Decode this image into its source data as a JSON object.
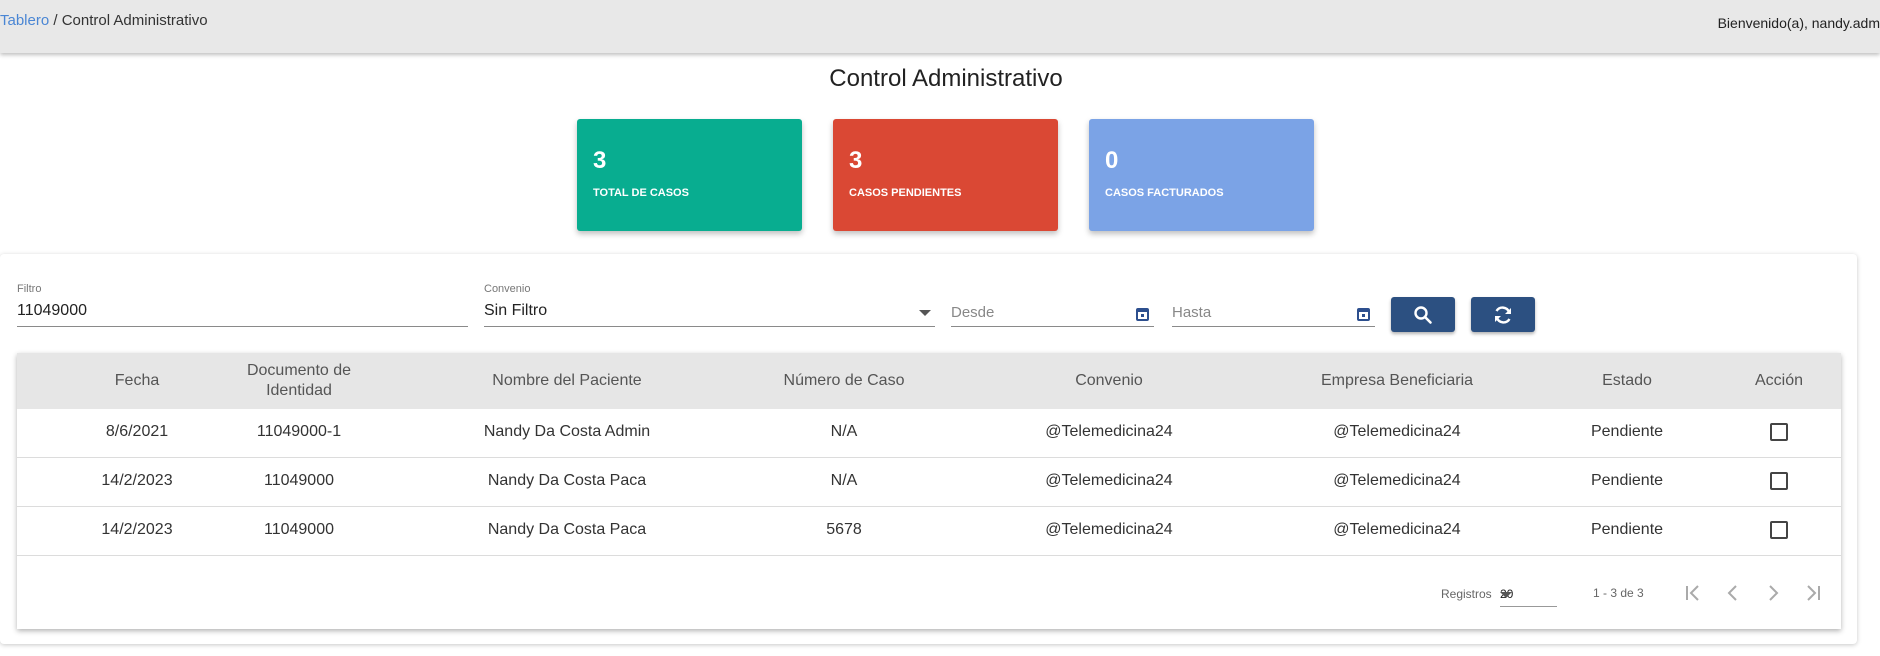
{
  "topbar": {
    "breadcrumb_link": "Tablero",
    "breadcrumb_sep": " / ",
    "breadcrumb_current": "Control Administrativo",
    "welcome": "Bienvenido(a), nandy.adm"
  },
  "page_title": "Control Administrativo",
  "stats": [
    {
      "value": "3",
      "label": "TOTAL DE CASOS",
      "color": "#08ad90"
    },
    {
      "value": "3",
      "label": "CASOS PENDIENTES",
      "color": "#da4834"
    },
    {
      "value": "0",
      "label": "CASOS FACTURADOS",
      "color": "#7ba3e6"
    }
  ],
  "filters": {
    "filtro_label": "Filtro",
    "filtro_value": "11049000",
    "convenio_label": "Convenio",
    "convenio_value": "Sin Filtro",
    "desde_placeholder": "Desde",
    "hasta_placeholder": "Hasta",
    "search_icon": "search-icon",
    "refresh_icon": "refresh-icon"
  },
  "table": {
    "headers": [
      "Fecha",
      "Documento de Identidad",
      "Nombre del Paciente",
      "Número de Caso",
      "Convenio",
      "Empresa Beneficiaria",
      "Estado",
      "Acción"
    ],
    "rows": [
      [
        "8/6/2021",
        "11049000-1",
        "Nandy Da Costa Admin",
        "N/A",
        "@Telemedicina24",
        "@Telemedicina24",
        "Pendiente"
      ],
      [
        "14/2/2023",
        "11049000",
        "Nandy Da Costa Paca",
        "N/A",
        "@Telemedicina24",
        "@Telemedicina24",
        "Pendiente"
      ],
      [
        "14/2/2023",
        "11049000",
        "Nandy Da Costa Paca",
        "5678",
        "@Telemedicina24",
        "@Telemedicina24",
        "Pendiente"
      ]
    ]
  },
  "paginator": {
    "label": "Registros",
    "page_size": "20",
    "range": "1 - 3 de 3"
  },
  "colors": {
    "primary_button": "#2c5081",
    "header_bar": "#e8e8e8",
    "link": "#4a86d4"
  }
}
